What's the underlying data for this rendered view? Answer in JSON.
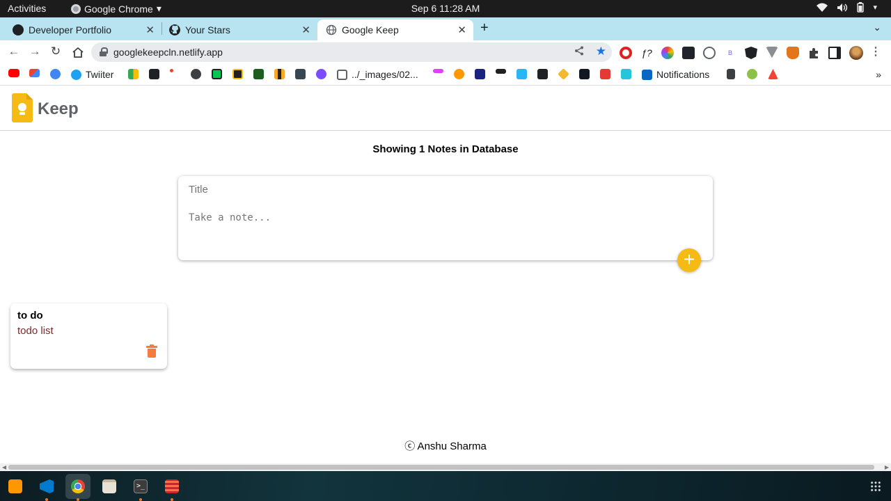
{
  "system_bar": {
    "activities": "Activities",
    "app_name": "Google Chrome",
    "clock": "Sep 6  11:28 AM"
  },
  "tabs": [
    {
      "title": "Developer Portfolio",
      "icon": "portfolio-icon",
      "active": false
    },
    {
      "title": "Your Stars",
      "icon": "github-icon",
      "active": false
    },
    {
      "title": "Google Keep",
      "icon": "globe-icon",
      "active": true
    }
  ],
  "omnibox": {
    "url": "googlekeepcln.netlify.app"
  },
  "bookmarks": {
    "twitter": "Twiiter",
    "images": "../_images/02...",
    "notifications": "Notifications"
  },
  "app": {
    "title": "Keep",
    "note_count_text": "Showing 1 Notes in Database",
    "composer": {
      "title_placeholder": "Title",
      "content_placeholder": "Take a note...",
      "add_label": "+"
    },
    "notes": [
      {
        "title": "to do",
        "content": "todo list"
      }
    ],
    "footer": "ⓒ Anshu Sharma"
  },
  "colors": {
    "keep_yellow": "#f5ba14",
    "delete_orange": "#f47c3c",
    "tabstrip_bg": "#b8e4f2",
    "note_content": "#7a2a2a"
  }
}
